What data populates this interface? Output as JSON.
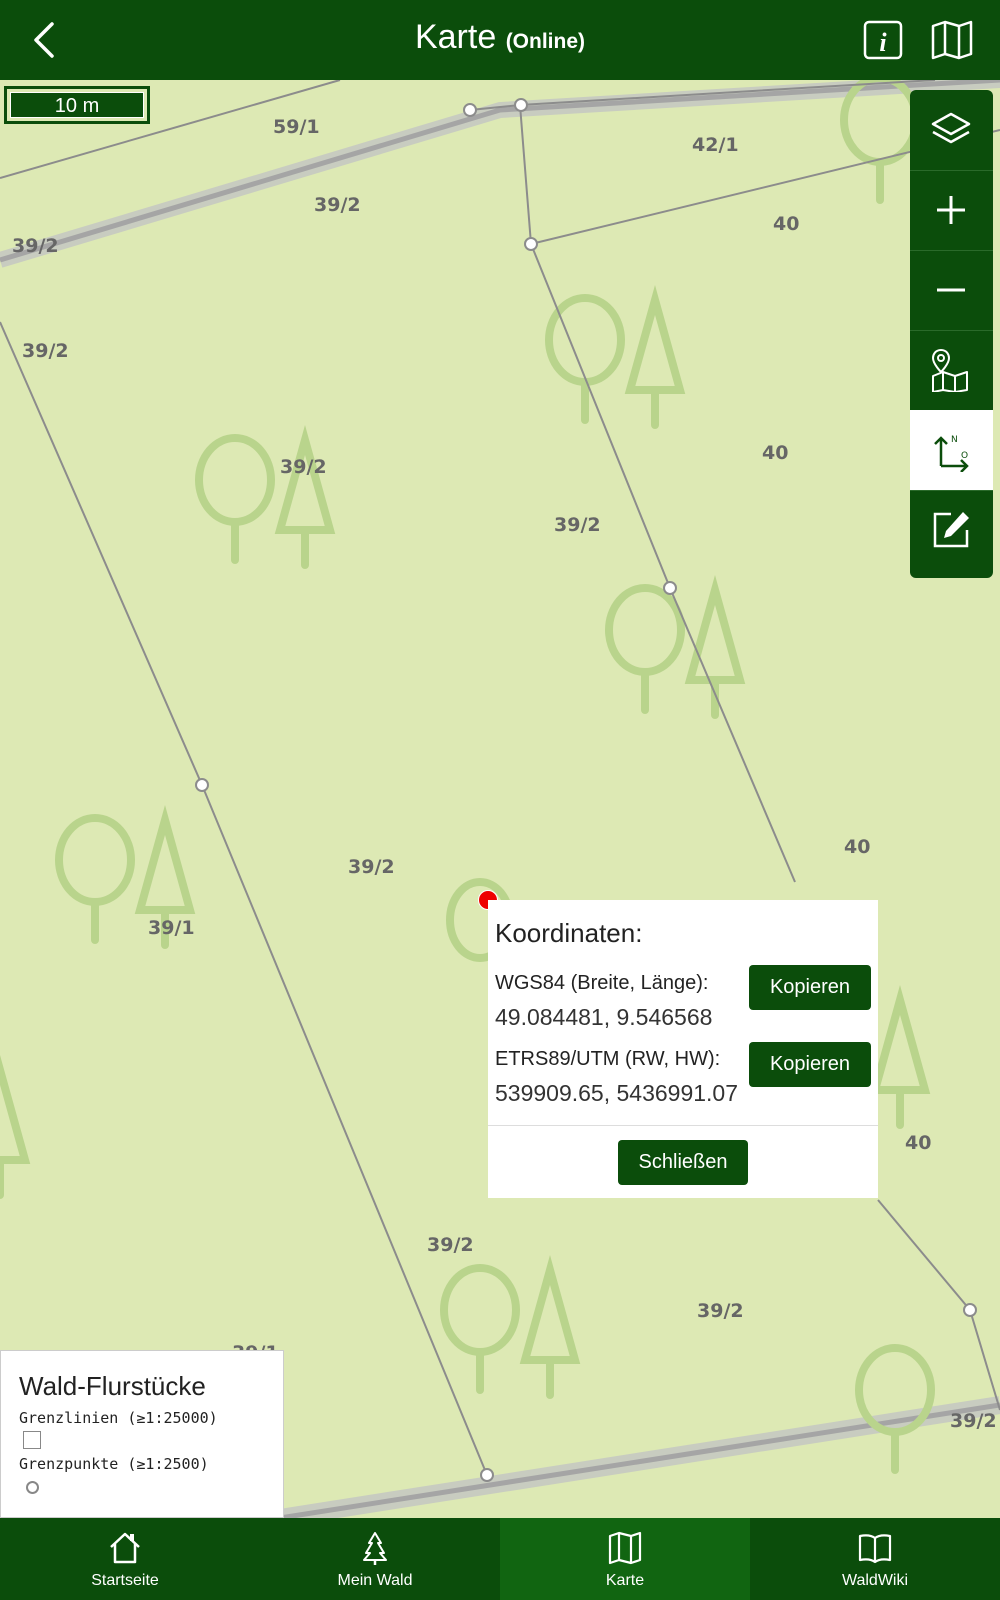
{
  "header": {
    "title": "Karte",
    "subtitle": "(Online)",
    "back_icon": "chevron-left-icon",
    "info_icon": "info-icon",
    "map_icon": "map-icon"
  },
  "map": {
    "scale_label": "10 m",
    "parcel_labels": [
      "59/1",
      "42/1",
      "39/2",
      "39/2",
      "40",
      "39/2",
      "39/2",
      "40",
      "39/2",
      "40",
      "39/2",
      "39/1",
      "40",
      "39/2",
      "39/2",
      "39/2",
      "39/1"
    ]
  },
  "toolbar": {
    "items": [
      {
        "icon": "layers-icon"
      },
      {
        "icon": "zoom-in-icon"
      },
      {
        "icon": "zoom-out-icon"
      },
      {
        "icon": "map-marker-icon"
      },
      {
        "icon": "coordinates-icon",
        "active": true
      },
      {
        "icon": "edit-icon"
      }
    ]
  },
  "popup": {
    "title": "Koordinaten:",
    "wgs_label": "WGS84 (Breite, Länge):",
    "wgs_value": "49.084481, 9.546568",
    "utm_label": "ETRS89/UTM (RW, HW):",
    "utm_value": "539909.65, 5436991.07",
    "copy_label": "Kopieren",
    "close_label": "Schließen"
  },
  "legend": {
    "title": "Wald-Flurstücke",
    "lines_label": "Grenzlinien (≥1:25000)",
    "points_label": "Grenzpunkte (≥1:2500)"
  },
  "nav": {
    "items": [
      {
        "label": "Startseite",
        "icon": "home-icon"
      },
      {
        "label": "Mein Wald",
        "icon": "tree-icon"
      },
      {
        "label": "Karte",
        "icon": "map-icon",
        "active": true
      },
      {
        "label": "WaldWiki",
        "icon": "book-icon"
      }
    ]
  },
  "colors": {
    "primary": "#0b4d0b",
    "map_background": "#dde9b4",
    "marker": "#ee0000"
  }
}
